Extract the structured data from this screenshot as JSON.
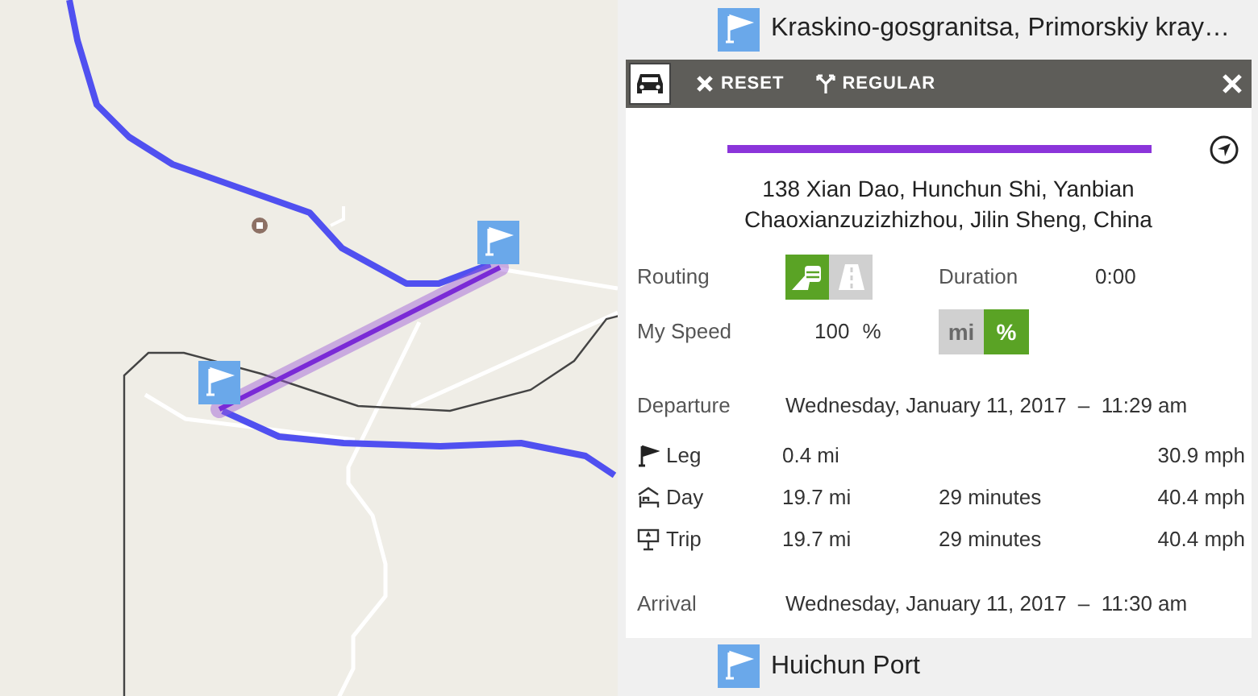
{
  "origin": {
    "name": "Kraskino-gosgranitsa, Primorskiy kray…"
  },
  "toolbar": {
    "buttons": [
      {
        "kind": "reset",
        "label": "RESET"
      },
      {
        "kind": "route",
        "label": "REGULAR"
      }
    ]
  },
  "segment": {
    "address": "138 Xian Dao, Hunchun Shi, Yanbian Chaoxianzuzizhizhou, Jilin Sheng, China"
  },
  "routing": {
    "label": "Routing",
    "options": [
      {
        "kind": "offroad",
        "selected": true
      },
      {
        "kind": "road",
        "selected": false
      }
    ]
  },
  "duration": {
    "label": "Duration",
    "value": "0:00"
  },
  "speed": {
    "label": "My Speed",
    "value": "100",
    "unit": "%",
    "units": [
      {
        "label": "mi",
        "selected": false
      },
      {
        "label": "%",
        "selected": true
      }
    ]
  },
  "departure": {
    "label": "Departure",
    "value": "Wednesday, January 11, 2017  –  11:29 am"
  },
  "stats": [
    {
      "kind": "leg",
      "label": "Leg",
      "distance": "0.4 mi",
      "speed": "30.9 mph"
    },
    {
      "kind": "day",
      "label": "Day",
      "distance": "19.7 mi",
      "time": "29 minutes",
      "speed": "40.4 mph"
    },
    {
      "kind": "trip",
      "label": "Trip",
      "distance": "19.7 mi",
      "time": "29 minutes",
      "speed": "40.4 mph"
    }
  ],
  "arrival": {
    "label": "Arrival",
    "value": "Wednesday, January 11, 2017  –  11:30 am"
  },
  "destination": {
    "name": "Huichun Port"
  }
}
